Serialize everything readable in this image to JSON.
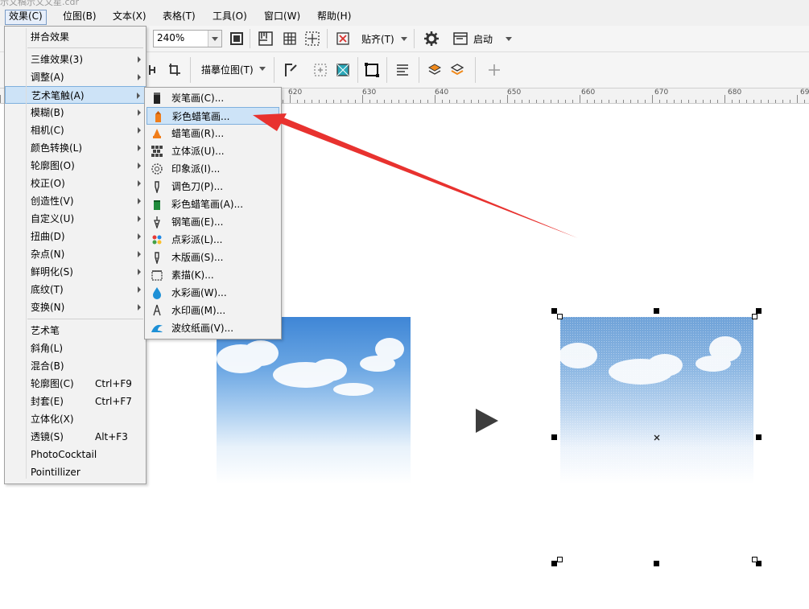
{
  "window": {
    "title_fragment": "示文稿示文文星.cdr"
  },
  "menubar": [
    {
      "label": "效果(C)",
      "active": true
    },
    {
      "label": "位图(B)"
    },
    {
      "label": "文本(X)"
    },
    {
      "label": "表格(T)"
    },
    {
      "label": "工具(O)"
    },
    {
      "label": "窗口(W)"
    },
    {
      "label": "帮助(H)"
    }
  ],
  "toolbar1": {
    "zoom_value": "240%",
    "snap_label": "贴齐(T)",
    "launch_label": "启动"
  },
  "toolbar2": {
    "trace_label": "描摹位图(T)"
  },
  "ruler": {
    "labels": [
      "620",
      "630",
      "640",
      "650",
      "660",
      "670",
      "680",
      "69"
    ]
  },
  "effects_menu": {
    "items": [
      {
        "label": "拼合效果"
      },
      {
        "label": "三维效果(3)",
        "submenu": true
      },
      {
        "label": "调整(A)",
        "submenu": true
      },
      {
        "label": "艺术笔触(A)",
        "submenu": true,
        "highlight": true
      },
      {
        "label": "模糊(B)",
        "submenu": true
      },
      {
        "label": "相机(C)",
        "submenu": true
      },
      {
        "label": "颜色转换(L)",
        "submenu": true
      },
      {
        "label": "轮廓图(O)",
        "submenu": true
      },
      {
        "label": "校正(O)",
        "submenu": true
      },
      {
        "label": "创造性(V)",
        "submenu": true
      },
      {
        "label": "自定义(U)",
        "submenu": true
      },
      {
        "label": "扭曲(D)",
        "submenu": true
      },
      {
        "label": "杂点(N)",
        "submenu": true
      },
      {
        "label": "鲜明化(S)",
        "submenu": true
      },
      {
        "label": "底纹(T)",
        "submenu": true
      },
      {
        "label": "变换(N)",
        "submenu": true
      }
    ],
    "items2": [
      {
        "label": "艺术笔"
      },
      {
        "label": "斜角(L)"
      },
      {
        "label": "混合(B)"
      },
      {
        "label": "轮廓图(C)",
        "shortcut": "Ctrl+F9"
      },
      {
        "label": "封套(E)",
        "shortcut": "Ctrl+F7"
      },
      {
        "label": "立体化(X)"
      },
      {
        "label": "透镜(S)",
        "shortcut": "Alt+F3"
      },
      {
        "label": "PhotoCocktail"
      },
      {
        "label": "Pointillizer"
      }
    ]
  },
  "art_strokes_submenu": {
    "items": [
      {
        "label": "炭笔画(C)...",
        "icon": "charcoal-icon"
      },
      {
        "label": "彩色蜡笔画...",
        "icon": "crayon-icon",
        "highlight": true
      },
      {
        "label": "蜡笔画(R)...",
        "icon": "wax-crayon-icon"
      },
      {
        "label": "立体派(U)...",
        "icon": "cubist-icon"
      },
      {
        "label": "印象派(I)...",
        "icon": "impressionist-icon"
      },
      {
        "label": "调色刀(P)...",
        "icon": "palette-knife-icon"
      },
      {
        "label": "彩色蜡笔画(A)...",
        "icon": "pastel-icon"
      },
      {
        "label": "钢笔画(E)...",
        "icon": "pen-ink-icon"
      },
      {
        "label": "点彩派(L)...",
        "icon": "pointillist-icon"
      },
      {
        "label": "木版画(S)...",
        "icon": "scraperboard-icon"
      },
      {
        "label": "素描(K)...",
        "icon": "sketch-pad-icon"
      },
      {
        "label": "水彩画(W)...",
        "icon": "watercolor-icon"
      },
      {
        "label": "水印画(M)...",
        "icon": "water-marker-icon"
      },
      {
        "label": "波纹纸画(V)...",
        "icon": "wave-paper-icon"
      }
    ]
  },
  "colors": {
    "highlight_bg": "#cde3f7",
    "highlight_border": "#7fb0de",
    "arrow": "#e8322f"
  }
}
